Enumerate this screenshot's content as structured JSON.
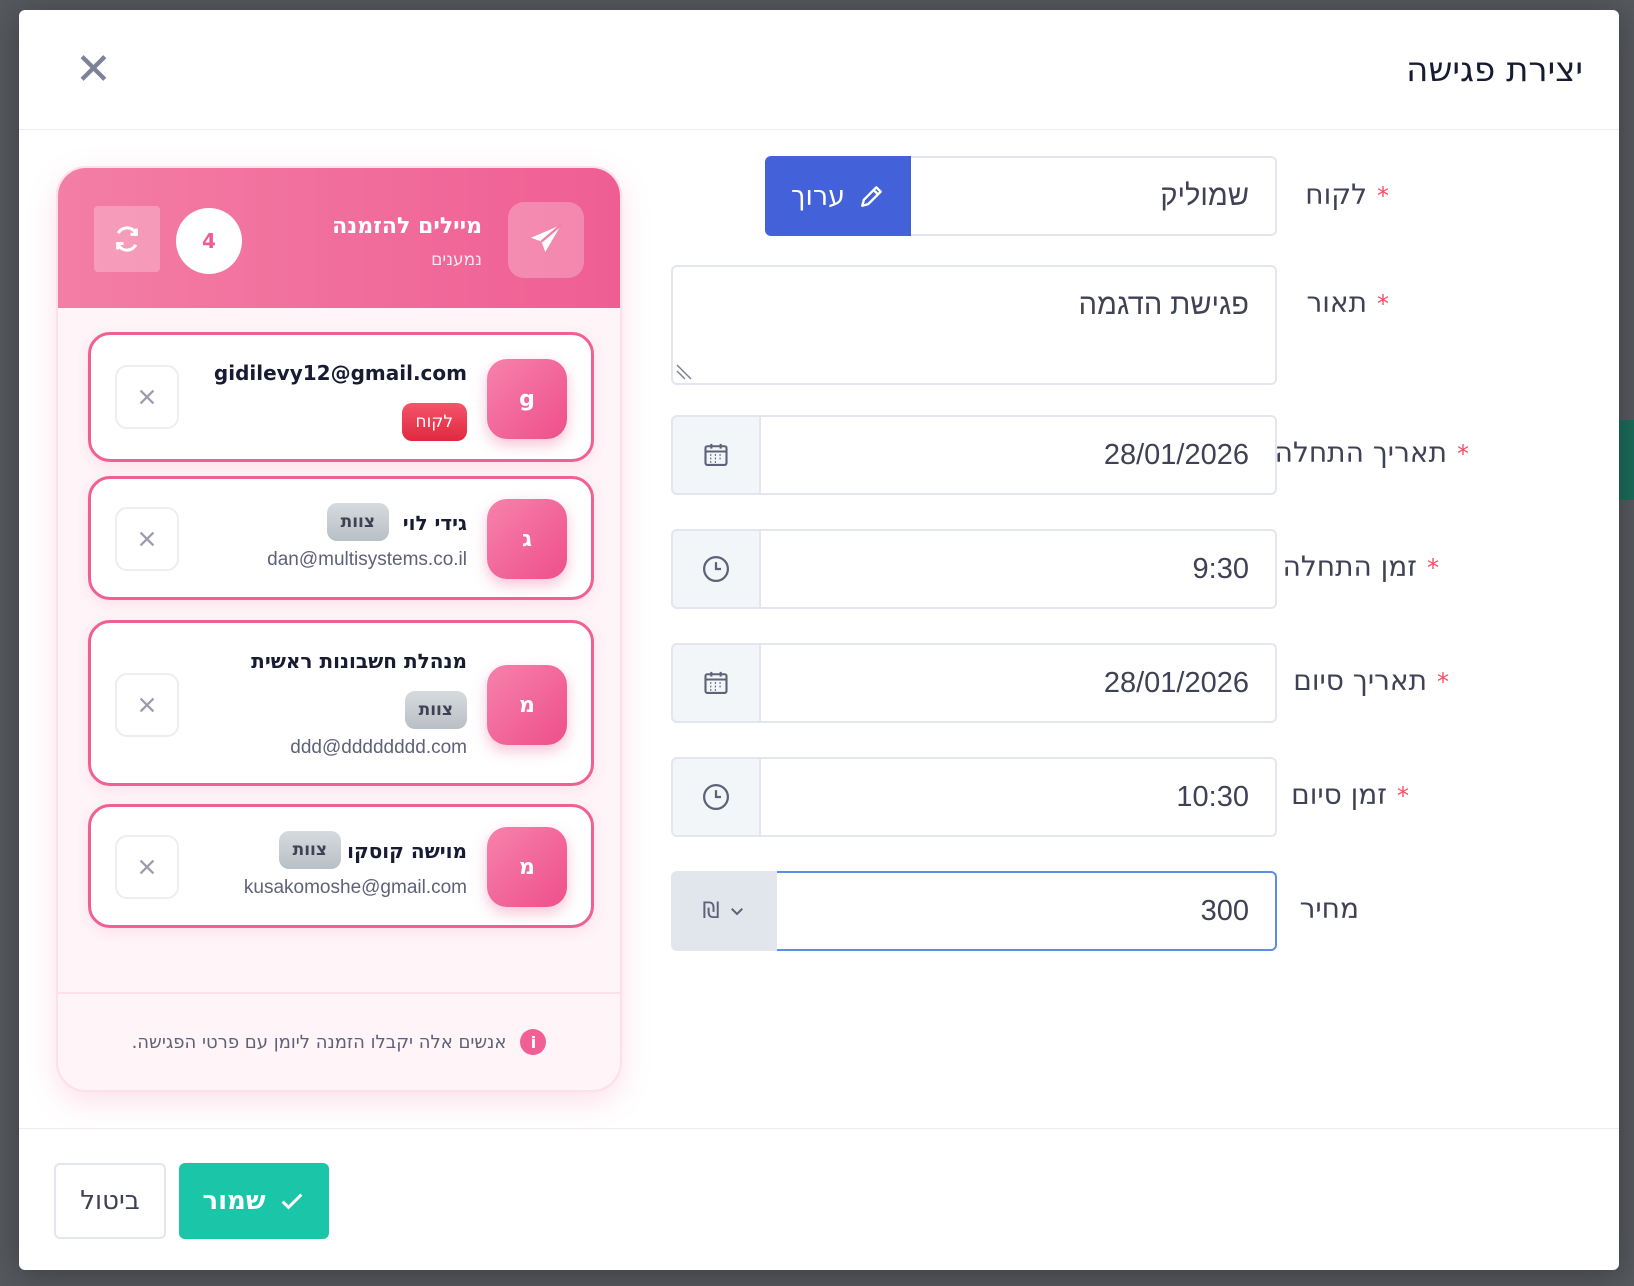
{
  "modal": {
    "title": "יצירת פגישה",
    "close_symbol": "✕"
  },
  "form": {
    "customer": {
      "label": "לקוח",
      "required": true,
      "value": "שמוליק",
      "edit_label": "ערוך"
    },
    "description": {
      "label": "תאור",
      "required": true,
      "value": "פגישת הדגמה"
    },
    "start_date": {
      "label": "תאריך התחלה",
      "required": true,
      "value": "28/01/2026"
    },
    "start_time": {
      "label": "זמן התחלה",
      "required": true,
      "value": "9:30"
    },
    "end_date": {
      "label": "תאריך סיום",
      "required": true,
      "value": "28/01/2026"
    },
    "end_time": {
      "label": "זמן סיום",
      "required": true,
      "value": "10:30"
    },
    "price": {
      "label": "מחיר",
      "required": false,
      "value": "300",
      "currency": "₪"
    },
    "required_mark": "*"
  },
  "invite_panel": {
    "title": "מיילים להזמנה",
    "subtitle": "נמענים",
    "count": "4",
    "recipients": [
      {
        "initial": "g",
        "name": "gidilevy12@gmail.com",
        "tag": "לקוח",
        "tag_type": "client",
        "email": ""
      },
      {
        "initial": "ג",
        "name": "גידי לוי",
        "tag": "צוות",
        "tag_type": "team",
        "email": "dan@multisystems.co.il"
      },
      {
        "initial": "מ",
        "name": "מנהלת חשבונות ראשית",
        "tag": "צוות",
        "tag_type": "team",
        "email": "ddd@dddddddd.com"
      },
      {
        "initial": "מ",
        "name": "מוישה קוסקו",
        "tag": "צוות",
        "tag_type": "team",
        "email": "kusakomoshe@gmail.com"
      }
    ],
    "footer_note": "אנשים אלה יקבלו הזמנה ליומן עם פרטי הפגישה.",
    "info_symbol": "i"
  },
  "footer": {
    "save_label": "שמור",
    "cancel_label": "ביטול"
  },
  "colors": {
    "accent_pink": "#ef5e93",
    "edit_blue": "#4361d8",
    "save_green": "#1bc5a8",
    "required_red": "#f64e60"
  },
  "icons": [
    "close-icon",
    "pencil-icon",
    "calendar-icon",
    "clock-icon",
    "chevron-down-icon",
    "paper-plane-icon",
    "refresh-icon",
    "remove-icon",
    "info-icon",
    "check-icon"
  ]
}
